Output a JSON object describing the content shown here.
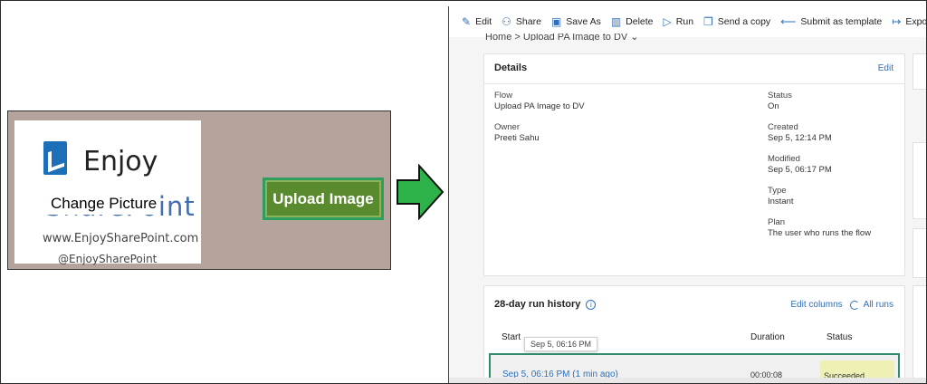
{
  "left_app": {
    "logo": {
      "brand_word": "Enjoy",
      "brand_word_2": "SharePoint",
      "url": "www.EnjoySharePoint.com",
      "handle": "@EnjoySharePoint"
    },
    "change_picture_label": "Change Picture",
    "upload_button_label": "Upload Image",
    "colors": {
      "panel_bg": "#b5a49b",
      "button_bg": "#5a8a2e",
      "button_border": "#2e9d5e"
    }
  },
  "arrow": {
    "color": "#2db34a"
  },
  "flow": {
    "commands": [
      {
        "label": "Edit",
        "icon": "pencil-icon"
      },
      {
        "label": "Share",
        "icon": "share-icon"
      },
      {
        "label": "Save As",
        "icon": "save-icon"
      },
      {
        "label": "Delete",
        "icon": "trash-icon"
      },
      {
        "label": "Run",
        "icon": "play-icon"
      },
      {
        "label": "Send a copy",
        "icon": "copy-icon"
      },
      {
        "label": "Submit as template",
        "icon": "submit-icon"
      },
      {
        "label": "Export",
        "icon": "export-icon"
      }
    ],
    "breadcrumb": "Home  >  Upload PA Image to DV  ⌄",
    "details": {
      "title": "Details",
      "edit_label": "Edit",
      "flow_label": "Flow",
      "flow_value": "Upload PA Image to DV",
      "owner_label": "Owner",
      "owner_value": "Preeti Sahu",
      "status_label": "Status",
      "status_value": "On",
      "created_label": "Created",
      "created_value": "Sep 5, 12:14 PM",
      "modified_label": "Modified",
      "modified_value": "Sep 5, 06:17 PM",
      "type_label": "Type",
      "type_value": "Instant",
      "plan_label": "Plan",
      "plan_value": "The user who runs the flow"
    },
    "run_history": {
      "title": "28-day run history",
      "edit_columns": "Edit columns",
      "all_runs": "All runs",
      "col_start": "Start",
      "col_duration": "Duration",
      "col_status": "Status",
      "tooltip": "Sep 5, 06:16 PM",
      "rows": [
        {
          "start": "Sep 5, 06:16 PM (1 min ago)",
          "duration": "00:00:08",
          "status": "Succeeded"
        }
      ]
    },
    "colors": {
      "accent": "#2f6fb8",
      "row_highlight": "#2e8b6e",
      "succeeded_bg": "#eef0b4"
    }
  }
}
